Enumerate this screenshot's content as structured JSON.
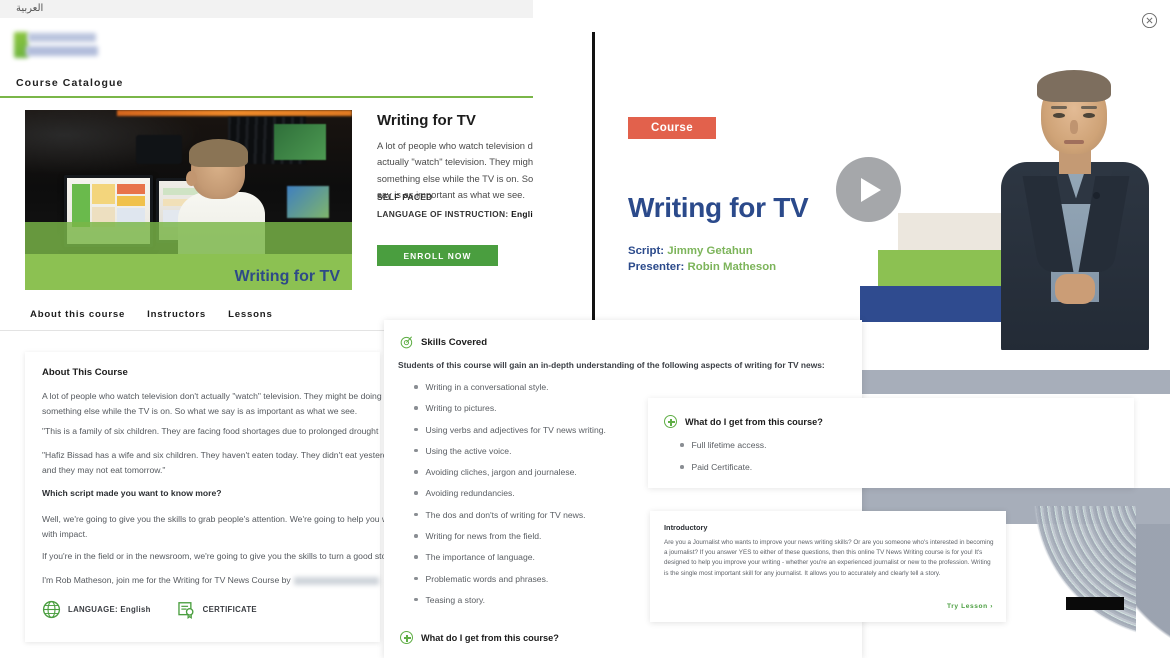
{
  "topbar": {
    "language_toggle": "العربية"
  },
  "header": {
    "catalogue_title": "Course Catalogue"
  },
  "hero": {
    "image_caption": "Writing for TV",
    "title": "Writing for TV",
    "description": "A lot of people who watch television don't actually \"watch\" television. They might be doing something else while the TV is on. So what we say is as important as what we see.",
    "self_paced": "SELF PACED",
    "language_label": "LANGUAGE OF INSTRUCTION:",
    "language_value": "English",
    "enroll_button": "ENROLL NOW"
  },
  "tabs": [
    {
      "label": "About this course"
    },
    {
      "label": "Instructors"
    },
    {
      "label": "Lessons"
    }
  ],
  "about": {
    "heading": "About This Course",
    "paragraphs": [
      "A lot of people who watch television don't actually \"watch\" television. They might be doing something else while the TV is on. So what we say is as important as what we see.",
      "\"This is a family of six children. They are facing food shortages due to prolonged drought",
      "\"Hafiz Bissad has a wife and six children. They haven't eaten today. They didn't eat yesterday and they may not eat tomorrow.\"",
      "Which script made you want to know more?",
      "Well, we're going to give you the skills to grab people's attention. We're going to help you write with impact.",
      "If you're in the field or in the newsroom, we're going to give you the skills to turn a good story",
      "I'm Rob Matheson, join me for the Writing for TV News Course by"
    ],
    "language_label": "LANGUAGE:",
    "language_value": "English",
    "certificate_label": "CERTIFICATE"
  },
  "video": {
    "badge": "Course",
    "title": "Writing for TV",
    "script_label": "Script:",
    "script_name": "Jimmy Getahun",
    "presenter_label": "Presenter:",
    "presenter_name": "Robin Matheson",
    "play_icon": "play-icon",
    "close_icon": "close-icon"
  },
  "skills": {
    "icon": "target-icon",
    "heading": "Skills Covered",
    "intro": "Students of this course will gain an in-depth understanding of the following aspects of writing for TV news:",
    "items": [
      "Writing in a conversational style.",
      "Writing to pictures.",
      "Using verbs and adjectives for TV news writing.",
      "Using the active voice.",
      "Avoiding cliches, jargon and journalese.",
      "Avoiding redundancies.",
      "The dos and don'ts of writing for TV news.",
      "Writing for news from the field.",
      "The importance of language.",
      "Problematic words and phrases.",
      "Teasing a story."
    ],
    "footer_question": "What do I get from this course?"
  },
  "get_from_course": {
    "heading": "What do I get from this course?",
    "items": [
      "Full lifetime access.",
      "Paid Certificate."
    ]
  },
  "introductory": {
    "title": "Introductory",
    "body": "Are you a Journalist who wants to improve your news writing skills? Or are you someone who's interested in becoming a journalist? If you answer YES to either of these questions, then this online TV News Writing course is for you! It's designed to help you improve your writing - whether you're an experienced journalist or new to the profession. Writing is the single most important skill for any journalist. It allows you to accurately and clearly tell a story.",
    "try_lesson": "Try Lesson  ›"
  },
  "colors": {
    "brand_green": "#4a9e3f",
    "light_green": "#8cc152",
    "badge_red": "#e2614c",
    "title_blue": "#2b4a8b",
    "deep_blue": "#2f4b8f",
    "scrim_grey": "#a7aeba"
  }
}
